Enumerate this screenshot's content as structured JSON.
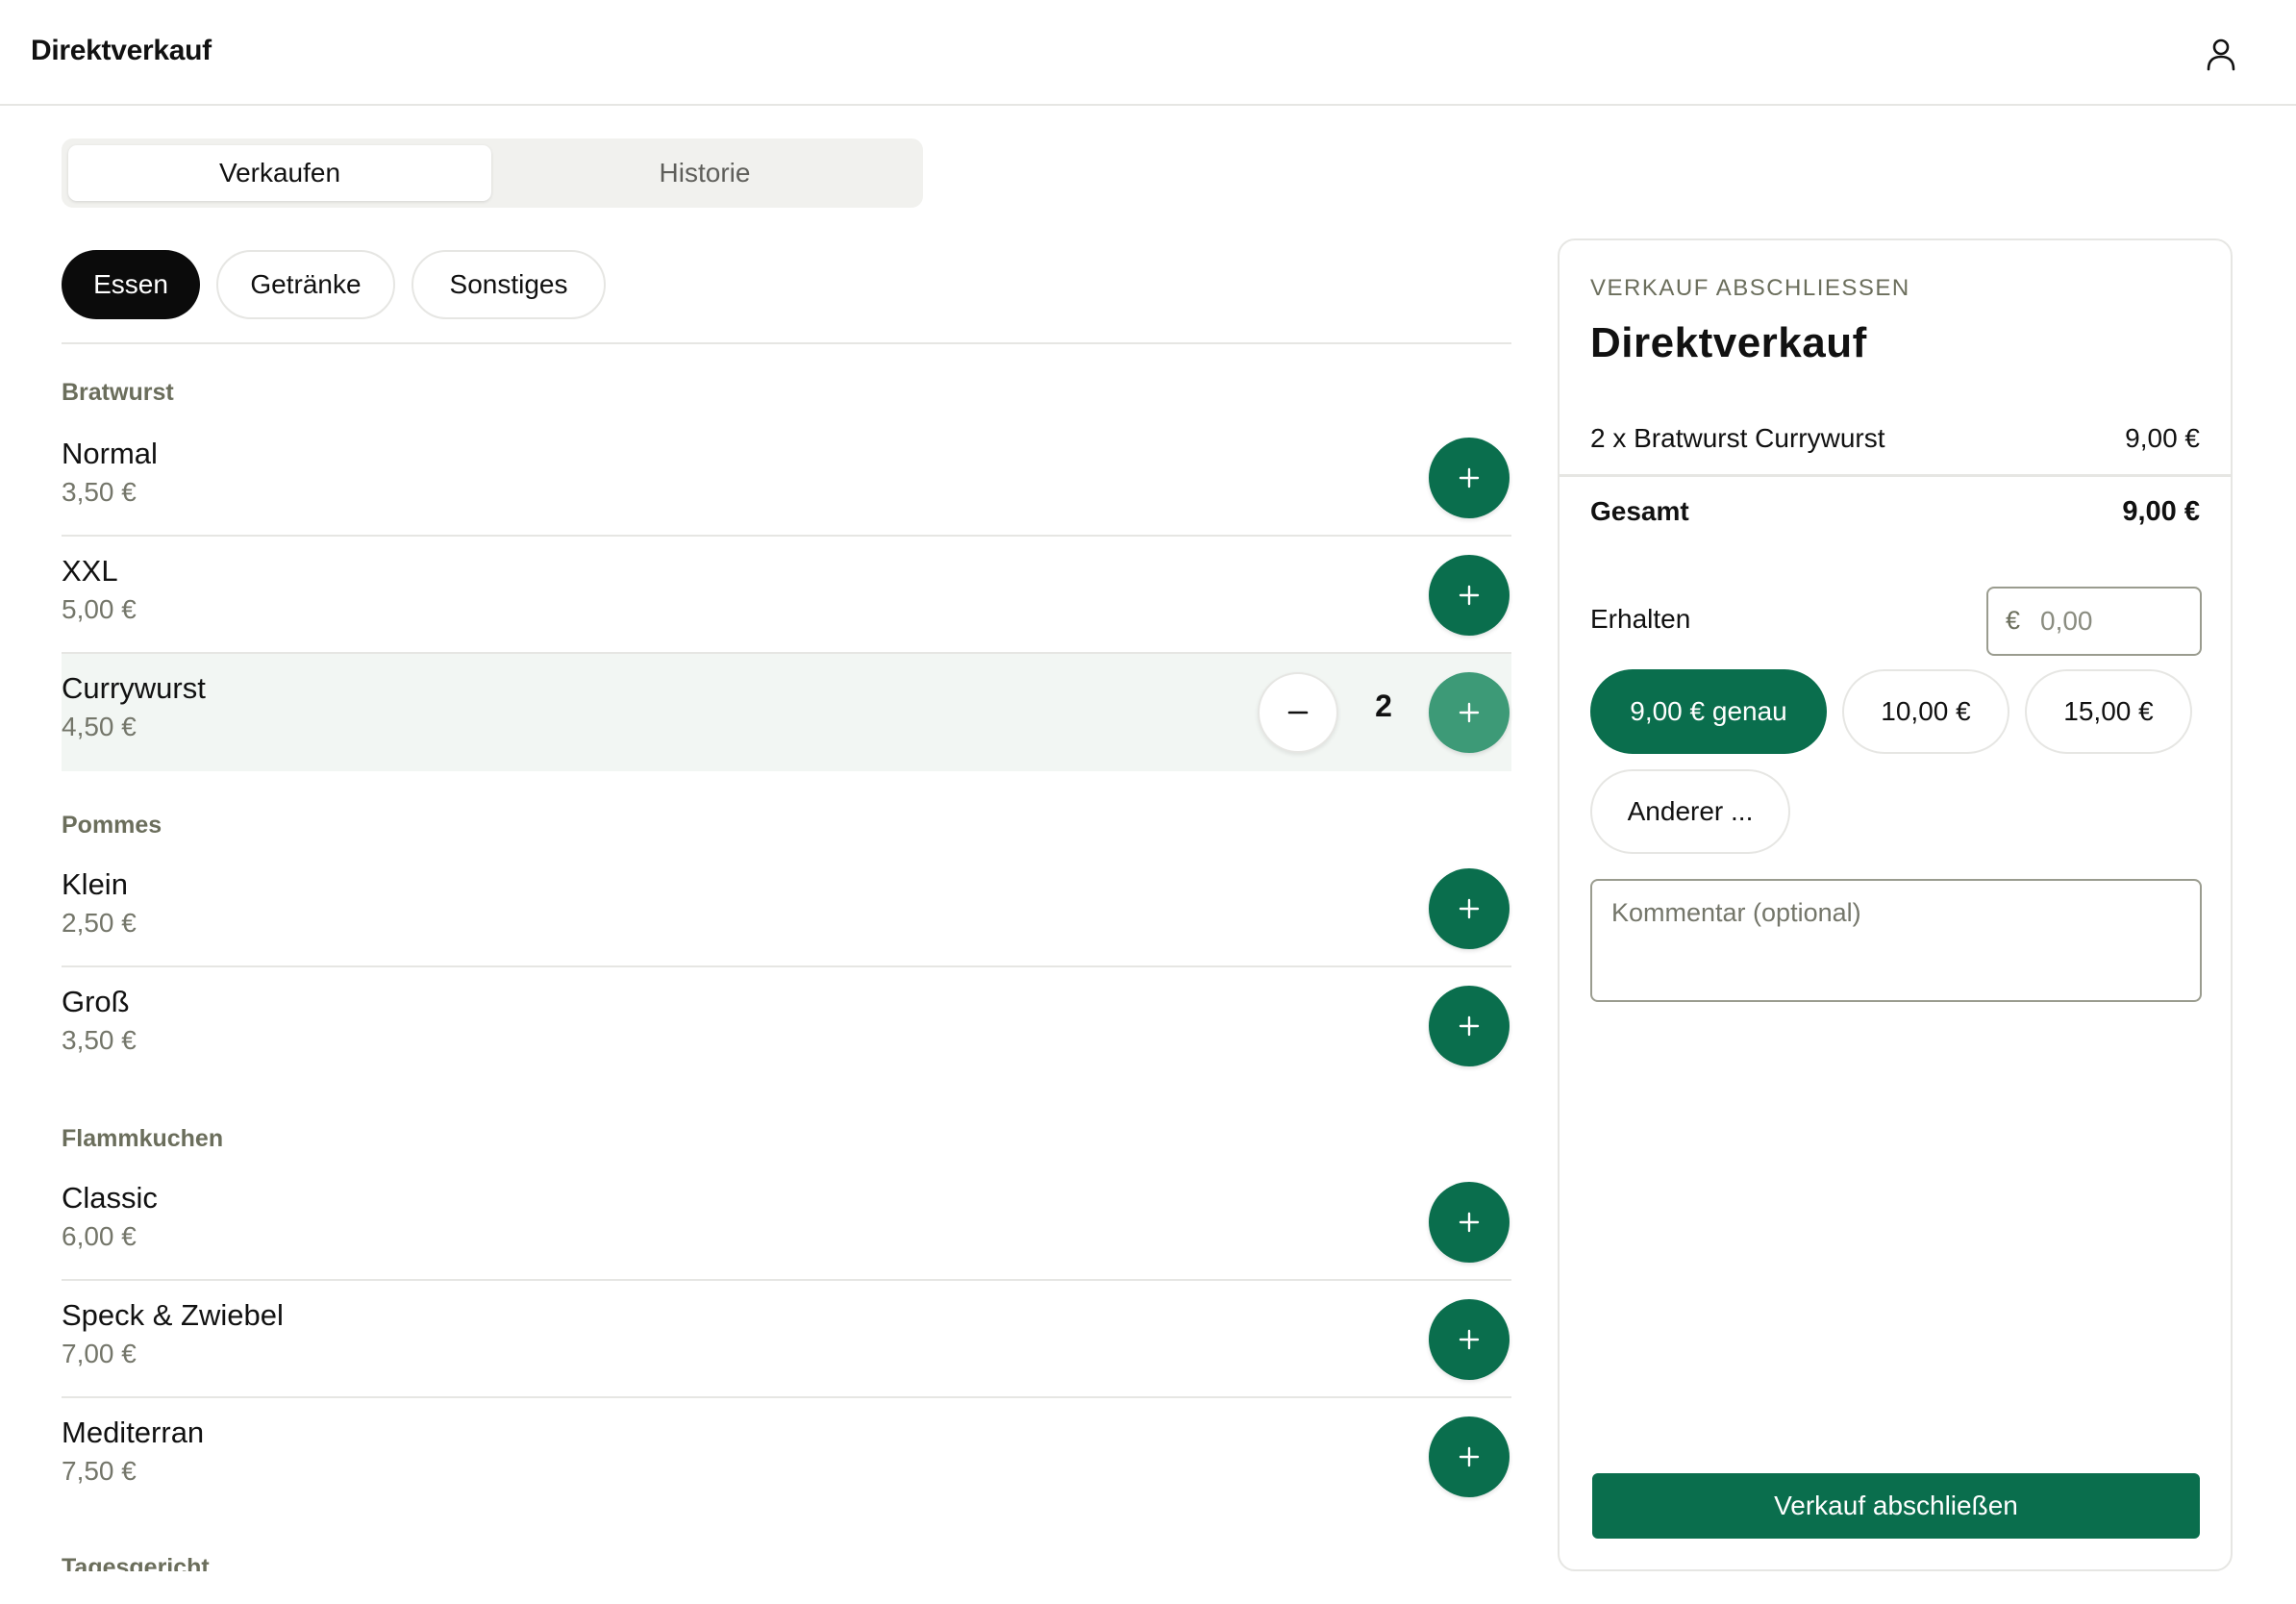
{
  "header": {
    "title": "Direktverkauf",
    "user_icon": "user-icon"
  },
  "tabs": [
    {
      "label": "Verkaufen"
    },
    {
      "label": "Historie"
    }
  ],
  "categories": [
    {
      "label": "Essen"
    },
    {
      "label": "Getränke"
    },
    {
      "label": "Sonstiges"
    }
  ],
  "groups": [
    {
      "label": "Bratwurst",
      "items": [
        {
          "name": "Normal",
          "price": "3,50 €"
        },
        {
          "name": "XXL",
          "price": "5,00 €"
        },
        {
          "name": "Currywurst",
          "price": "4,50 €",
          "quantity": "2"
        }
      ]
    },
    {
      "label": "Pommes",
      "items": [
        {
          "name": "Klein",
          "price": "2,50 €"
        },
        {
          "name": "Groß",
          "price": "3,50 €"
        }
      ]
    },
    {
      "label": "Flammkuchen",
      "items": [
        {
          "name": "Classic",
          "price": "6,00 €"
        },
        {
          "name": "Speck & Zwiebel",
          "price": "7,00 €"
        },
        {
          "name": "Mediterran",
          "price": "7,50 €"
        }
      ]
    },
    {
      "label": "Tagesgericht",
      "items": []
    }
  ],
  "checkout": {
    "kicker": "VERKAUF ABSCHLIESSEN",
    "title": "Direktverkauf",
    "lines": [
      {
        "text": "2 x Bratwurst Currywurst",
        "amount": "9,00 €"
      }
    ],
    "total_label": "Gesamt",
    "total_value": "9,00 €",
    "received_label": "Erhalten",
    "received_currency": "€",
    "received_placeholder": "0,00",
    "quick_amounts": [
      "9,00 € genau",
      "10,00 €",
      "15,00 €",
      "Anderer ..."
    ],
    "comment_placeholder": "Kommentar (optional)",
    "submit_label": "Verkauf abschließen"
  },
  "colors": {
    "accent": "#0a6e4d",
    "accent_light": "#3d9a77",
    "muted_text": "#74766a",
    "section_label": "#6b6e5c",
    "border": "#e6e6e3"
  }
}
